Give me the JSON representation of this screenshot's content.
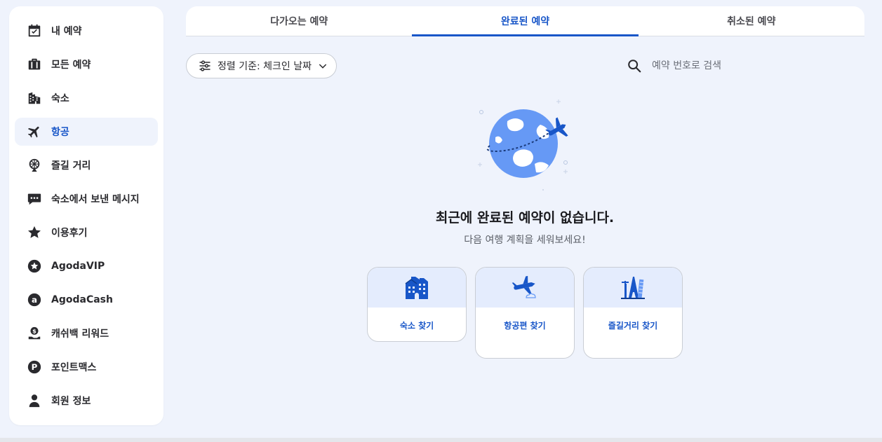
{
  "sidebar": {
    "items": [
      {
        "label": "내 예약",
        "icon": "calendar-check-icon",
        "active": false
      },
      {
        "label": "모든 예약",
        "icon": "briefcase-icon",
        "active": false
      },
      {
        "label": "숙소",
        "icon": "building-icon",
        "active": false
      },
      {
        "label": "항공",
        "icon": "airplane-icon",
        "active": true
      },
      {
        "label": "즐길 거리",
        "icon": "ferris-wheel-icon",
        "active": false
      },
      {
        "label": "숙소에서 보낸 메시지",
        "icon": "chat-bubble-icon",
        "active": false
      },
      {
        "label": "이용후기",
        "icon": "star-icon",
        "active": false
      },
      {
        "label": "AgodaVIP",
        "icon": "vip-star-badge-icon",
        "active": false
      },
      {
        "label": "AgodaCash",
        "icon": "agoda-cash-icon",
        "active": false
      },
      {
        "label": "캐쉬백 리워드",
        "icon": "cashback-hand-icon",
        "active": false
      },
      {
        "label": "포인트맥스",
        "icon": "pointsmax-p-icon",
        "active": false
      },
      {
        "label": "회원 정보",
        "icon": "person-icon",
        "active": false
      }
    ]
  },
  "tabs": [
    {
      "label": "다가오는 예약",
      "active": false
    },
    {
      "label": "완료된 예약",
      "active": true
    },
    {
      "label": "취소된 예약",
      "active": false
    }
  ],
  "sort": {
    "label": "정렬 기준: 체크인 날짜"
  },
  "search": {
    "placeholder": "예약 번호로 검색"
  },
  "empty_state": {
    "illustration": "globe-with-airplane",
    "title": "최근에 완료된 예약이 없습니다.",
    "subtitle": "다음 여행 계획을 세워보세요!",
    "cards": [
      {
        "label": "숙소 찾기",
        "icon": "hotel-icon"
      },
      {
        "label": "항공편 찾기",
        "icon": "flight-icon"
      },
      {
        "label": "즐길거리 찾기",
        "icon": "landmarks-icon"
      }
    ]
  },
  "colors": {
    "accent": "#1856c8",
    "background": "#eff3fc",
    "card_top": "#e4ecfd"
  }
}
